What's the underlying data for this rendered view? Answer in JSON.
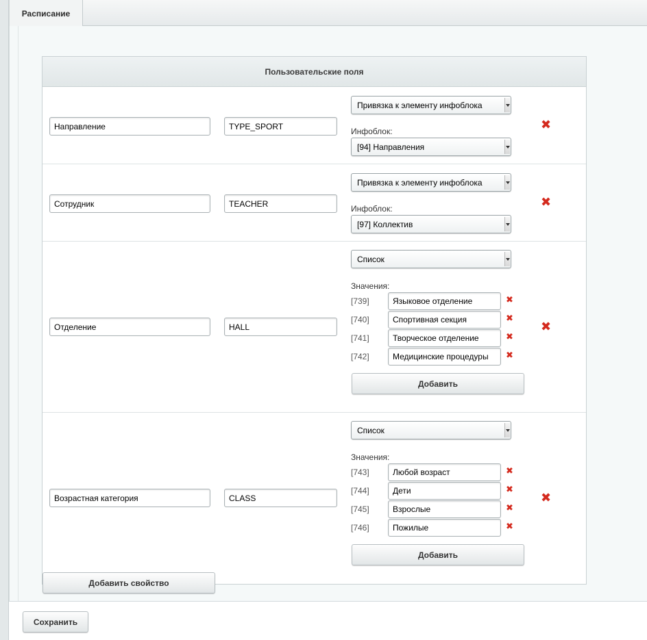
{
  "tabs": [
    {
      "label": "Расписание",
      "active": true
    }
  ],
  "section_title": "Пользовательские поля",
  "fields": [
    {
      "name": "Направление",
      "code": "TYPE_SPORT",
      "type": "Привязка к элементу инфоблока",
      "iblock_label": "Инфоблок:",
      "iblock": "[94] Направления"
    },
    {
      "name": "Сотрудник",
      "code": "TEACHER",
      "type": "Привязка к элементу инфоблока",
      "iblock_label": "Инфоблок:",
      "iblock": "[97] Коллектив"
    },
    {
      "name": "Отделение",
      "code": "HALL",
      "type": "Список",
      "values_label": "Значения:",
      "values": [
        {
          "id": "[739]",
          "value": "Языковое отделение"
        },
        {
          "id": "[740]",
          "value": "Спортивная секция"
        },
        {
          "id": "[741]",
          "value": "Творческое отделение"
        },
        {
          "id": "[742]",
          "value": "Медицинские процедуры"
        }
      ],
      "add_label": "Добавить"
    },
    {
      "name": "Возрастная категория",
      "code": "CLASS",
      "type": "Список",
      "values_label": "Значения:",
      "values": [
        {
          "id": "[743]",
          "value": "Любой возраст"
        },
        {
          "id": "[744]",
          "value": "Дети"
        },
        {
          "id": "[745]",
          "value": "Взрослые"
        },
        {
          "id": "[746]",
          "value": "Пожилые"
        }
      ],
      "add_label": "Добавить"
    }
  ],
  "add_property_label": "Добавить свойство",
  "save_label": "Сохранить",
  "icons": {
    "delete": "close-x-icon",
    "delete_color": "#d42a1e"
  }
}
